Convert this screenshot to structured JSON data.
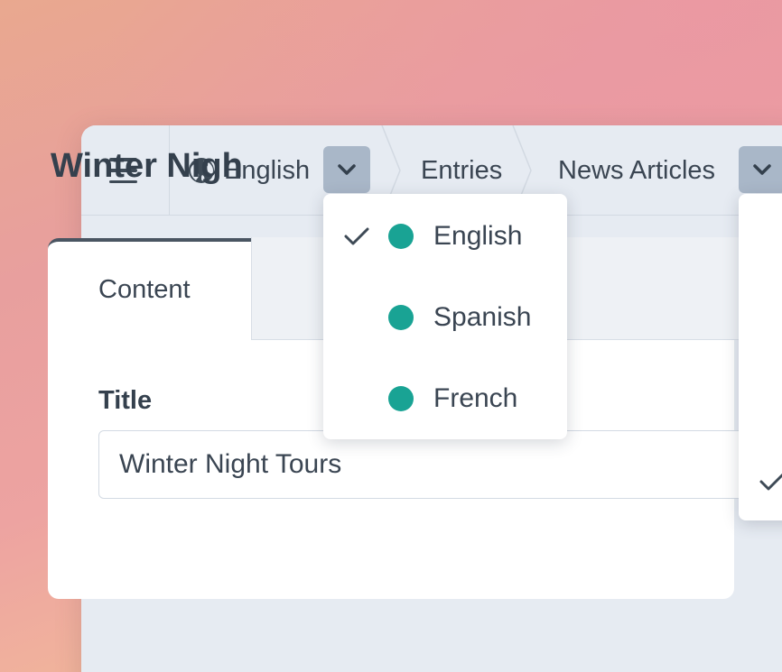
{
  "breadcrumb": {
    "language": "English",
    "entries": "Entries",
    "collection": "News Articles"
  },
  "page": {
    "title": "Winter Nigh"
  },
  "tabs": [
    {
      "label": "Content"
    }
  ],
  "fields": {
    "title_label": "Title",
    "title_value": "Winter Night Tours"
  },
  "language_menu": {
    "items": [
      {
        "label": "English",
        "selected": true,
        "dot_color": "#19a394"
      },
      {
        "label": "Spanish",
        "selected": false,
        "dot_color": "#19a394"
      },
      {
        "label": "French",
        "selected": false,
        "dot_color": "#19a394"
      }
    ]
  },
  "colors": {
    "accent": "#19a394",
    "caret_button": "#a9b7c8",
    "text": "#3a4552"
  }
}
